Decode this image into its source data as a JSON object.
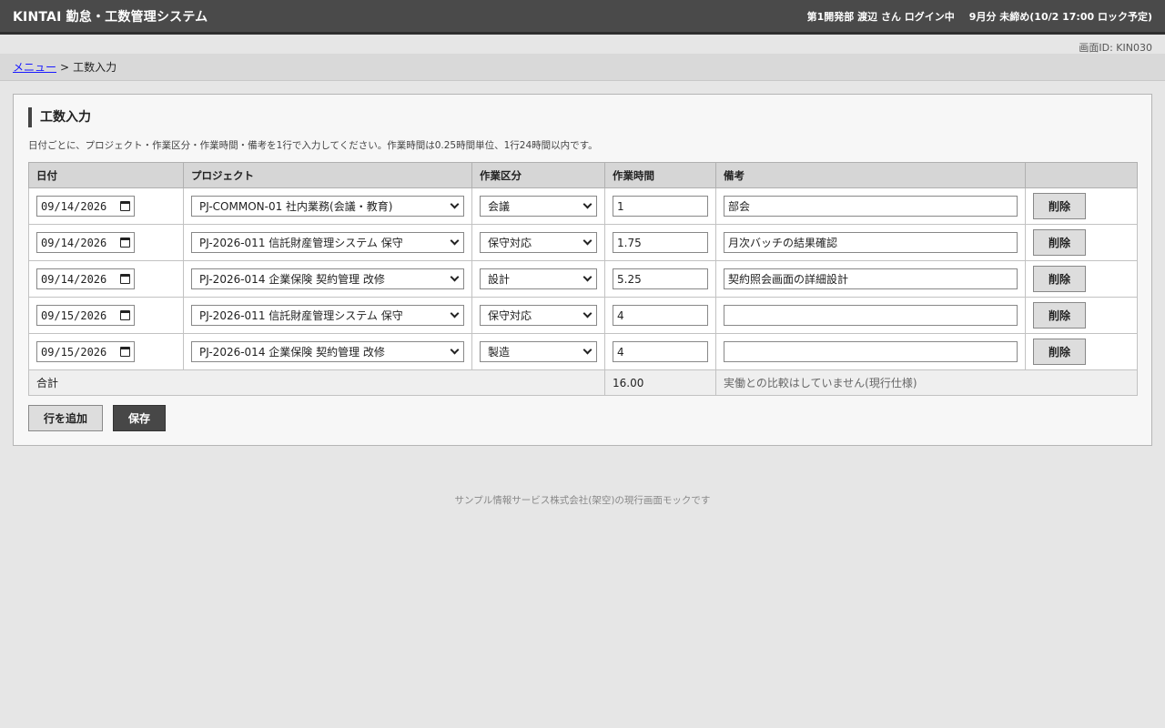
{
  "header": {
    "app_title": "KINTAI 勤怠・工数管理システム",
    "user_status": "第1開発部 渡辺 さん ログイン中",
    "period_status": "9月分 未締め(10/2 17:00 ロック予定)"
  },
  "screen_id": "画面ID: KIN030",
  "breadcrumb": {
    "menu": "メニュー",
    "separator": ">",
    "current": "工数入力"
  },
  "panel": {
    "title": "工数入力",
    "instruction": "日付ごとに、プロジェクト・作業区分・作業時間・備考を1行で入力してください。作業時間は0.25時間単位、1行24時間以内です。"
  },
  "table": {
    "headers": {
      "date": "日付",
      "project": "プロジェクト",
      "category": "作業区分",
      "hours": "作業時間",
      "note": "備考",
      "action": ""
    },
    "rows": [
      {
        "date": "09/14/2026",
        "project": "PJ-COMMON-01 社内業務(会議・教育)",
        "category": "会議",
        "hours": "1",
        "note": "部会",
        "delete": "削除"
      },
      {
        "date": "09/14/2026",
        "project": "PJ-2026-011 信託財産管理システム 保守",
        "category": "保守対応",
        "hours": "1.75",
        "note": "月次バッチの結果確認",
        "delete": "削除"
      },
      {
        "date": "09/14/2026",
        "project": "PJ-2026-014 企業保険 契約管理 改修",
        "category": "設計",
        "hours": "5.25",
        "note": "契約照会画面の詳細設計",
        "delete": "削除"
      },
      {
        "date": "09/15/2026",
        "project": "PJ-2026-011 信託財産管理システム 保守",
        "category": "保守対応",
        "hours": "4",
        "note": "",
        "delete": "削除"
      },
      {
        "date": "09/15/2026",
        "project": "PJ-2026-014 企業保険 契約管理 改修",
        "category": "製造",
        "hours": "4",
        "note": "",
        "delete": "削除"
      }
    ],
    "total": {
      "label": "合計",
      "hours": "16.00",
      "note": "実働との比較はしていません(現行仕様)"
    }
  },
  "actions": {
    "add_row": "行を追加",
    "save": "保存"
  },
  "footer": "サンプル情報サービス株式会社(架空)の現行画面モックです"
}
